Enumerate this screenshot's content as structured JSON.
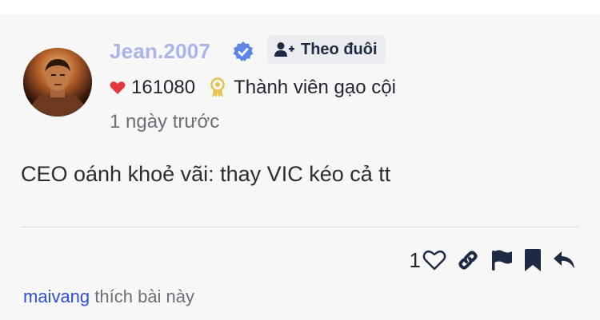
{
  "post": {
    "author": {
      "username": "Jean.2007",
      "verified": true,
      "likes": "161080",
      "rank": "Thành viên gạo cội"
    },
    "follow_label": "Theo đuôi",
    "time": "1 ngày trước",
    "content": "CEO oánh khoẻ vãi: thay VIC kéo cả tt",
    "like_count": "1",
    "liked_by": {
      "user": "maivang",
      "text": "thích bài này"
    }
  },
  "colors": {
    "username": "#aab3ea",
    "verified": "#5b86e5",
    "heart": "#e23a3a",
    "award": "#e6c34a",
    "link": "#2c4ed8",
    "icon_dark": "#1e2a44"
  },
  "icons": {
    "verified": "verified-badge-icon",
    "follow": "add-user-icon",
    "heart": "heart-icon",
    "award": "award-icon",
    "like": "heart-outline-icon",
    "link": "link-icon",
    "report": "flag-icon",
    "bookmark": "bookmark-icon",
    "reply": "reply-icon"
  }
}
